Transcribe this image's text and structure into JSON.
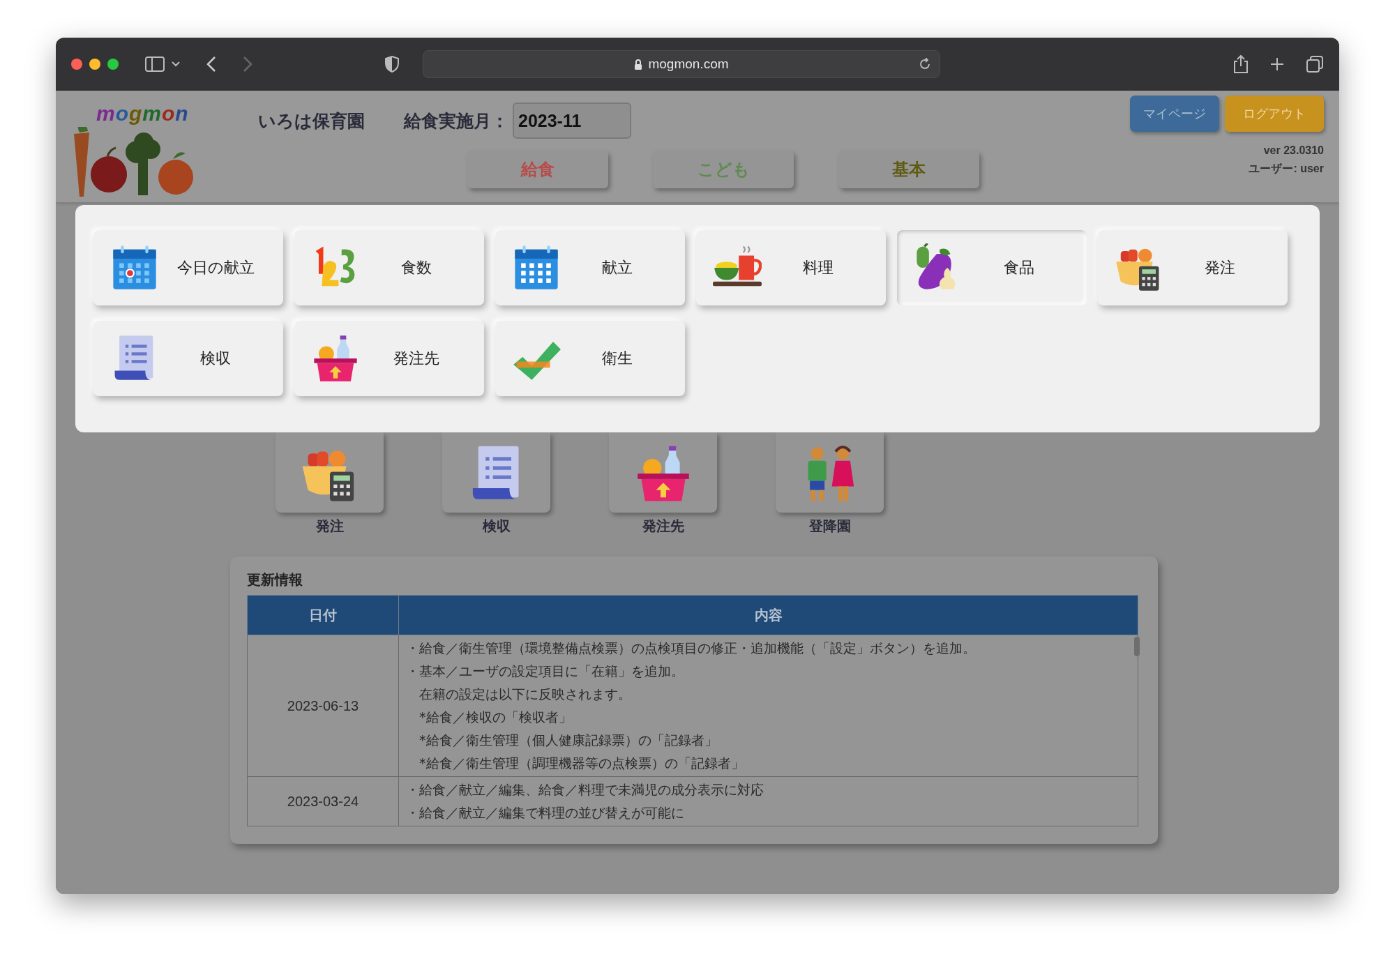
{
  "browser": {
    "url": "mogmon.com"
  },
  "header": {
    "logo_text": "mogmon",
    "facility": "いろは保育園",
    "month_label": "給食実施月：",
    "month_value": "2023-11",
    "tabs": [
      {
        "label": "給食",
        "color": "#b94a4a"
      },
      {
        "label": "こども",
        "color": "#5f8a52"
      },
      {
        "label": "基本",
        "color": "#5e5a10"
      }
    ],
    "buttons": [
      "マイページ",
      "ログアウト"
    ],
    "version": "ver 23.0310",
    "user": "ユーザー: user"
  },
  "menu": {
    "items": [
      {
        "label": "今日の献立",
        "selected": false
      },
      {
        "label": "食数",
        "selected": false
      },
      {
        "label": "献立",
        "selected": false
      },
      {
        "label": "料理",
        "selected": false
      },
      {
        "label": "食品",
        "selected": true
      },
      {
        "label": "発注",
        "selected": false
      },
      {
        "label": "検収",
        "selected": false
      },
      {
        "label": "発注先",
        "selected": false
      },
      {
        "label": "衛生",
        "selected": false
      }
    ]
  },
  "shortcuts": [
    {
      "label": "発注"
    },
    {
      "label": "検収"
    },
    {
      "label": "発注先"
    },
    {
      "label": "登降園"
    }
  ],
  "updates": {
    "title": "更新情報",
    "columns": [
      "日付",
      "内容"
    ],
    "rows": [
      {
        "date": "2023-06-13",
        "lines": [
          "・給食／衛生管理（環境整備点検票）の点検項目の修正・追加機能（「設定」ボタン）を追加。",
          "・基本／ユーザの設定項目に「在籍」を追加。",
          "　在籍の設定は以下に反映されます。",
          "　*給食／検収の「検収者」",
          "　*給食／衛生管理（個人健康記録票）の「記録者」",
          "　*給食／衛生管理（調理機器等の点検票）の「記録者」"
        ]
      },
      {
        "date": "2023-03-24",
        "lines": [
          "・給食／献立／編集、給食／料理で未満児の成分表示に対応",
          "・給食／献立／編集で料理の並び替えが可能に"
        ]
      }
    ]
  }
}
